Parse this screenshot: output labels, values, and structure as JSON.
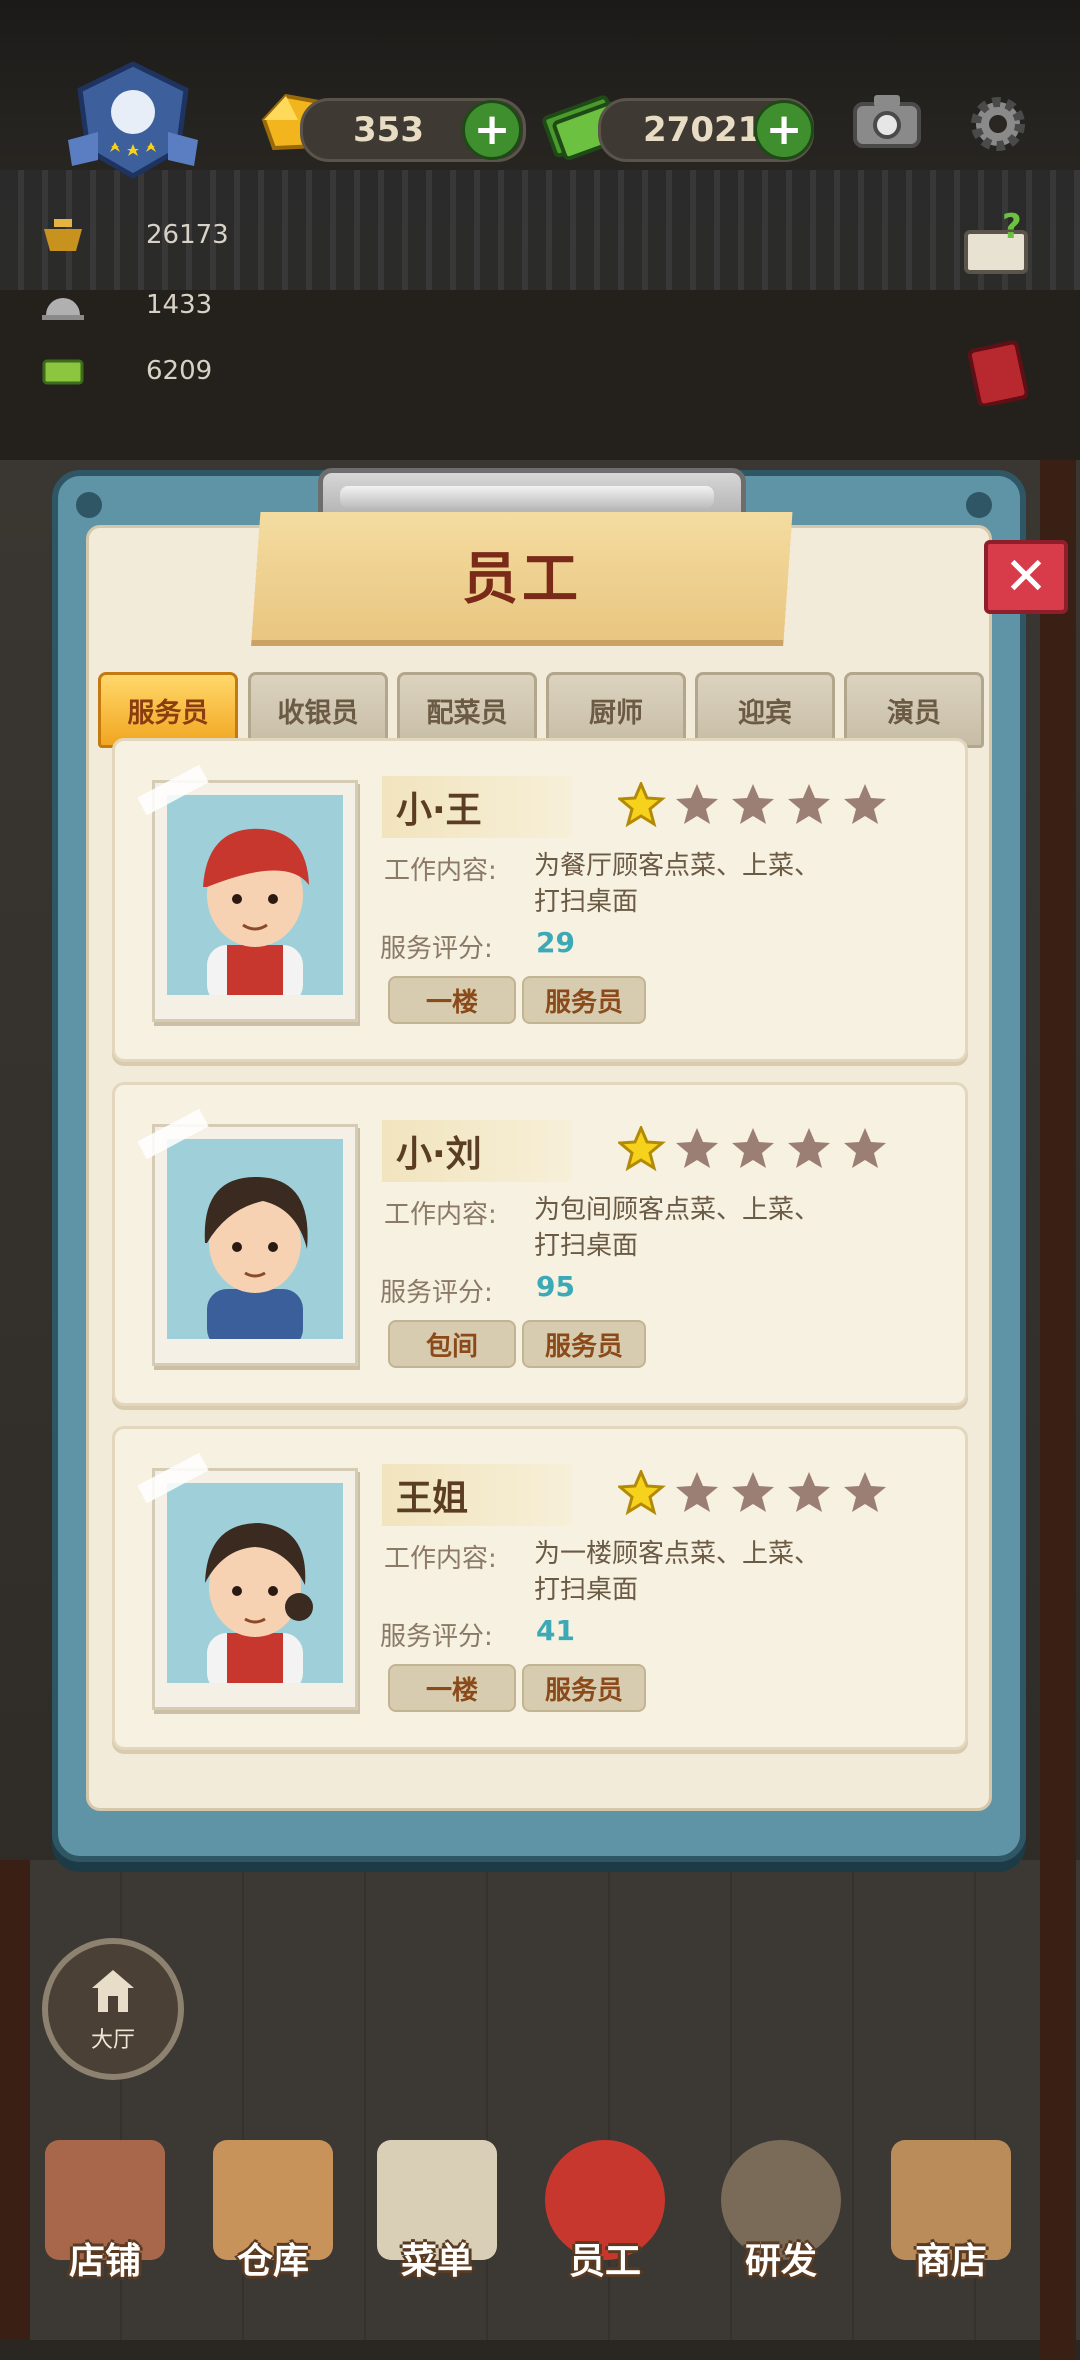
{
  "hud": {
    "gold": "353",
    "cash": "270217",
    "stat_1": "26173",
    "stat_2": "1433",
    "stat_3": "6209"
  },
  "panel": {
    "title": "员工",
    "close_symbol": "✕"
  },
  "tabs": [
    {
      "label": "服务员",
      "active": true
    },
    {
      "label": "收银员",
      "active": false
    },
    {
      "label": "配菜员",
      "active": false
    },
    {
      "label": "厨师",
      "active": false
    },
    {
      "label": "迎宾",
      "active": false
    },
    {
      "label": "演员",
      "active": false
    }
  ],
  "labels": {
    "work_content": "工作内容:",
    "service_score": "服务评分:"
  },
  "staff": [
    {
      "name": "小·王",
      "stars": 1,
      "max_stars": 5,
      "desc_line1": "为餐厅顾客点菜、上菜、",
      "desc_line2": "打扫桌面",
      "score": "29",
      "tag_location": "一楼",
      "tag_role": "服务员"
    },
    {
      "name": "小·刘",
      "stars": 1,
      "max_stars": 5,
      "desc_line1": "为包间顾客点菜、上菜、",
      "desc_line2": "打扫桌面",
      "score": "95",
      "tag_location": "包间",
      "tag_role": "服务员"
    },
    {
      "name": "王姐",
      "stars": 1,
      "max_stars": 5,
      "desc_line1": "为一楼顾客点菜、上菜、",
      "desc_line2": "打扫桌面",
      "score": "41",
      "tag_location": "一楼",
      "tag_role": "服务员"
    }
  ],
  "hall_button": "大厅",
  "bottom_nav": [
    {
      "label": "店铺",
      "icon": "shop-icon"
    },
    {
      "label": "仓库",
      "icon": "warehouse-icon"
    },
    {
      "label": "菜单",
      "icon": "menu-clipboard-icon"
    },
    {
      "label": "员工",
      "icon": "staff-icon"
    },
    {
      "label": "研发",
      "icon": "research-pot-icon"
    },
    {
      "label": "商店",
      "icon": "store-icon"
    }
  ],
  "colors": {
    "panel_blue": "#5f93a6",
    "tab_active": "#f1a621",
    "score": "#3ba9b6",
    "close_red": "#d83b4a",
    "star_on": "#f7d21c",
    "star_off": "#9c7f74"
  }
}
